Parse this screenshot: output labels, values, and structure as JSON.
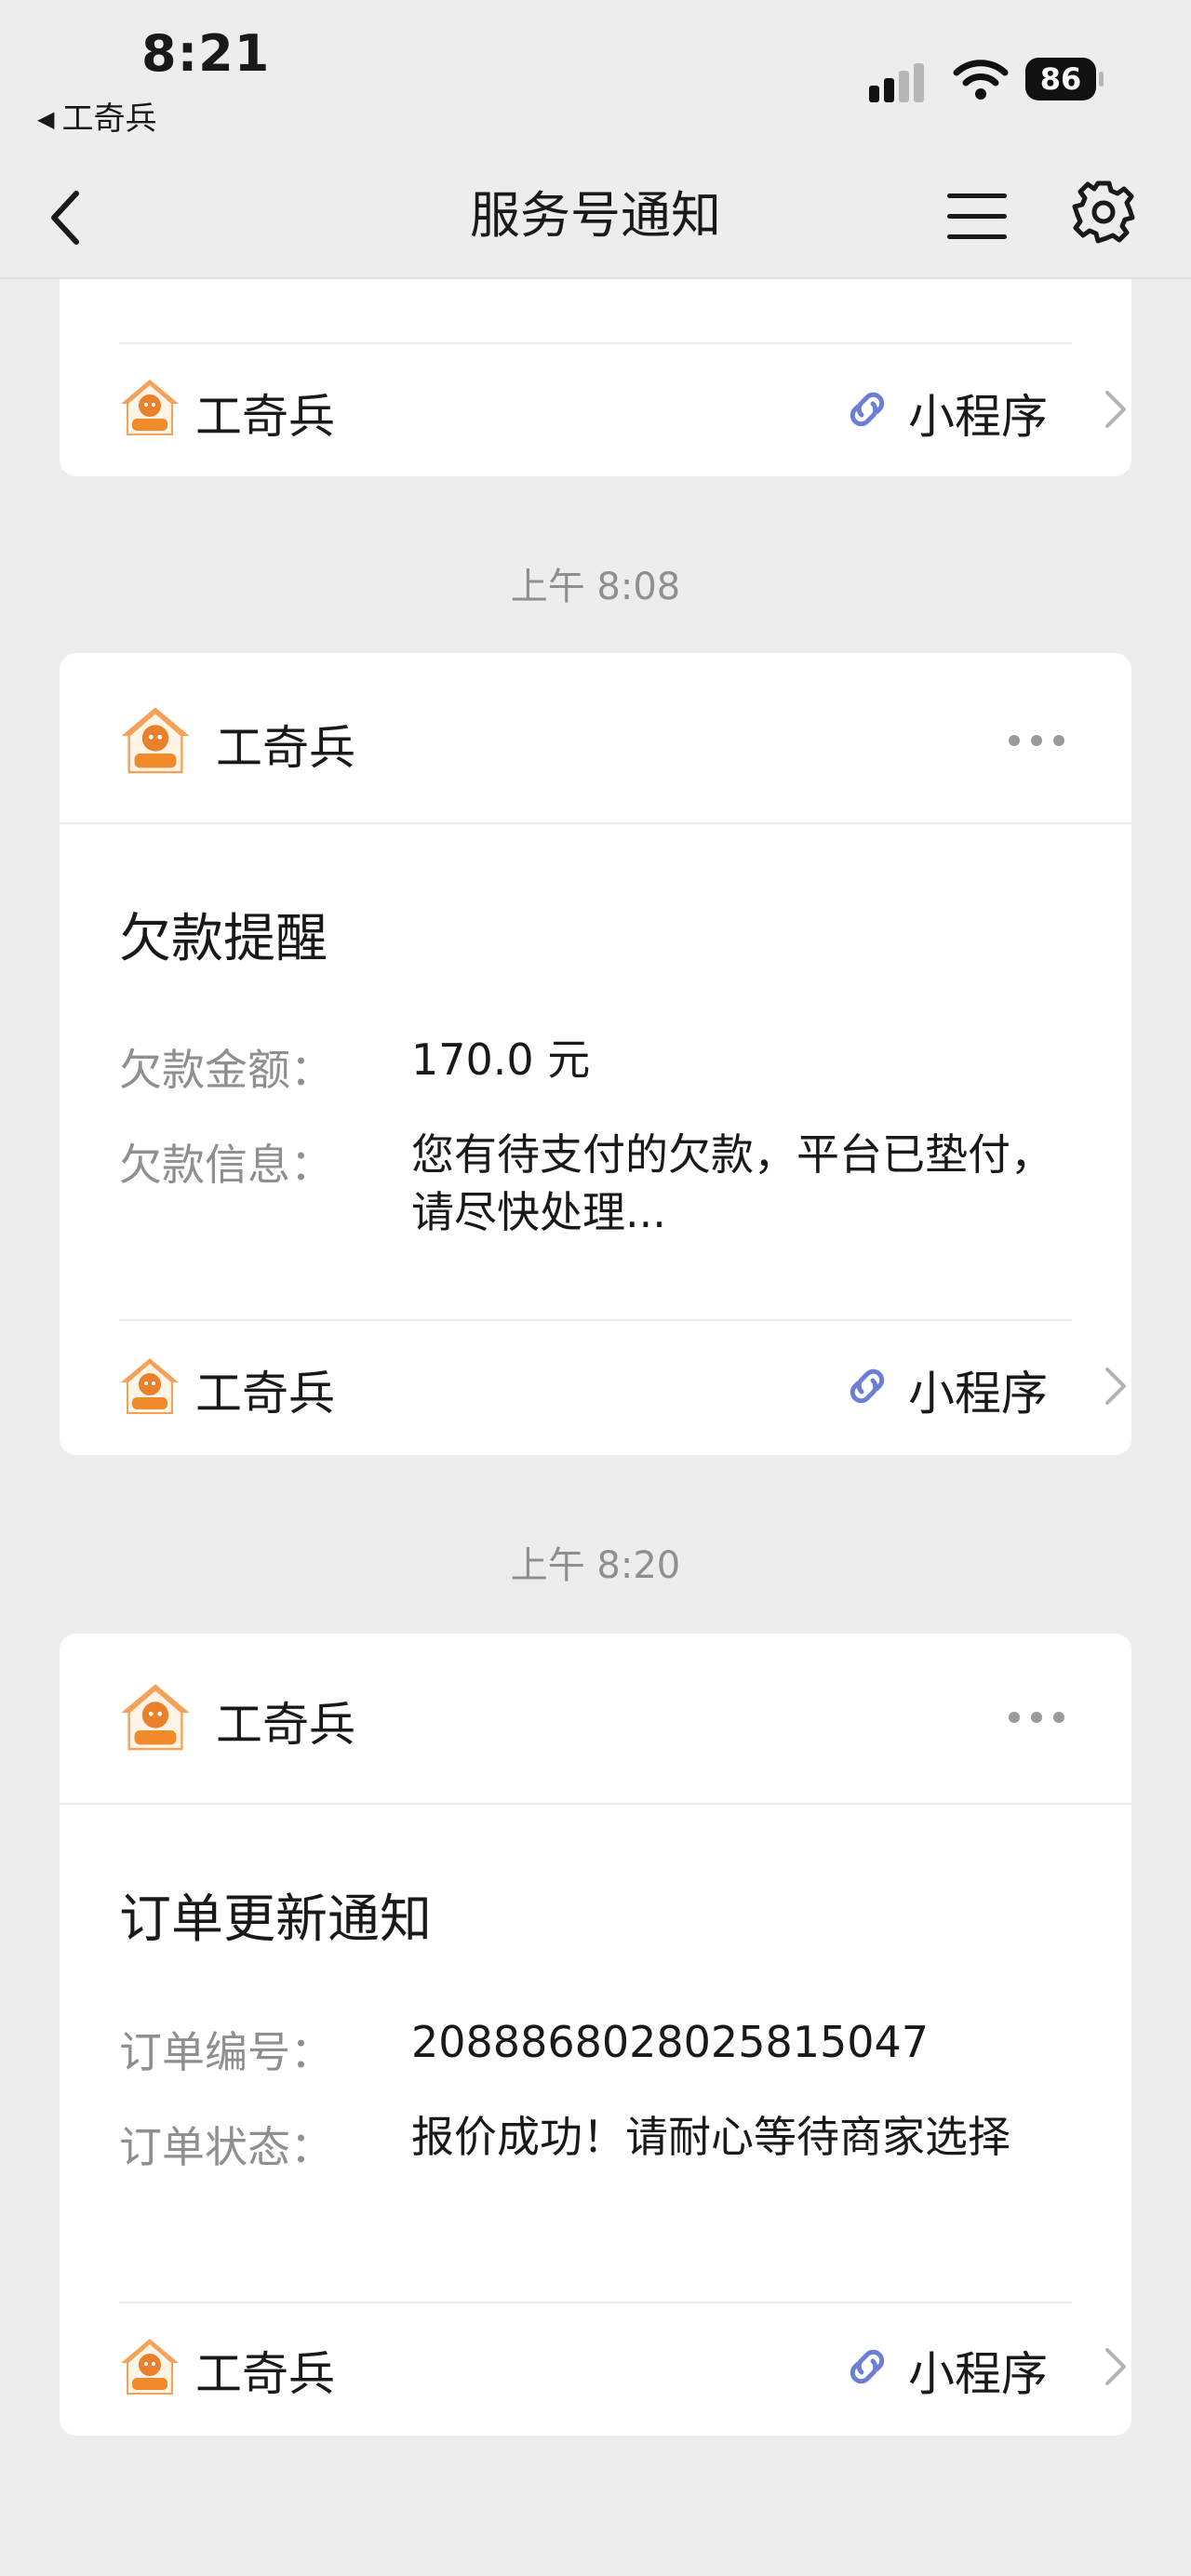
{
  "status_bar": {
    "time": "8:21",
    "back_app": "工奇兵",
    "battery": "86"
  },
  "nav": {
    "title": "服务号通知",
    "icons": [
      "back-chevron-icon",
      "menu-icon",
      "gear-icon"
    ]
  },
  "cards": [
    {
      "brand": "工奇兵",
      "mini_program": "小程序"
    },
    {
      "timestamp": "上午 8:08",
      "brand": "工奇兵",
      "title": "欠款提醒",
      "fields": [
        {
          "label": "欠款金额：",
          "value": "170.0 元"
        },
        {
          "label": "欠款信息：",
          "value": "您有待支付的欠款，平台已垫付，请尽快处理..."
        }
      ],
      "footer_brand": "工奇兵",
      "mini_program": "小程序"
    },
    {
      "timestamp": "上午 8:20",
      "brand": "工奇兵",
      "title": "订单更新通知",
      "fields": [
        {
          "label": "订单编号：",
          "value": "2088868028025815047"
        },
        {
          "label": "订单状态：",
          "value": "报价成功！请耐心等待商家选择"
        }
      ],
      "footer_brand": "工奇兵",
      "mini_program": "小程序"
    }
  ],
  "colors": {
    "background": "#ededed",
    "link_icon": "#6b7fd7",
    "logo_orange": "#f08a2b"
  }
}
